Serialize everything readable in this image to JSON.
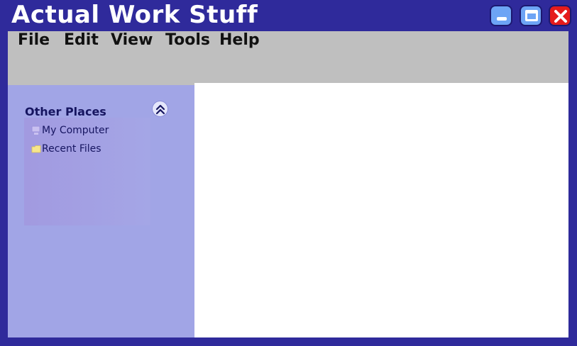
{
  "window": {
    "title": "Actual Work Stuff",
    "controls": [
      "minimize",
      "maximize",
      "close"
    ]
  },
  "menu": {
    "items": [
      {
        "label": "File"
      },
      {
        "label": "Edit"
      },
      {
        "label": "View"
      },
      {
        "label": "Tools"
      },
      {
        "label": "Help"
      }
    ]
  },
  "sidebar": {
    "panel_title": "Other Places",
    "places": [
      {
        "label": "My Computer",
        "icon": "computer-icon"
      },
      {
        "label": "Recent Files",
        "icon": "folder-icon"
      }
    ]
  },
  "colors": {
    "frame": "#2f2a9b",
    "menubar": "#bfbfbf",
    "sidebar": "#a1a5e6",
    "close": "#e51b1b",
    "window_button": "#6da4f5"
  }
}
